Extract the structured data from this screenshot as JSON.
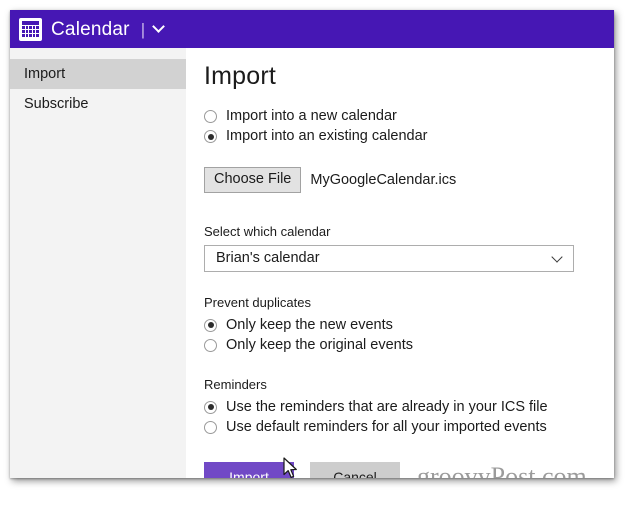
{
  "window": {
    "titlebar": {
      "icon": "calendar-icon",
      "app_title": "Calendar",
      "separator": "|",
      "chevron": "chevron-down-icon"
    }
  },
  "sidebar": {
    "items": [
      {
        "label": "Import",
        "selected": true
      },
      {
        "label": "Subscribe",
        "selected": false
      }
    ]
  },
  "main": {
    "page_title": "Import",
    "destination_options": [
      {
        "label": "Import into a new calendar",
        "selected": false
      },
      {
        "label": "Import into an existing calendar",
        "selected": true
      }
    ],
    "file_picker": {
      "button_label": "Choose File",
      "file_name": "MyGoogleCalendar.ics"
    },
    "calendar_group": {
      "label": "Select which calendar",
      "selected_value": "Brian's calendar",
      "chevron": "chevron-down-icon"
    },
    "duplicates_group": {
      "label": "Prevent duplicates",
      "options": [
        {
          "label": "Only keep the new events",
          "selected": true
        },
        {
          "label": "Only keep the original events",
          "selected": false
        }
      ]
    },
    "reminders_group": {
      "label": "Reminders",
      "options": [
        {
          "label": "Use the reminders that are already in your ICS file",
          "selected": true
        },
        {
          "label": "Use default reminders for all your imported events",
          "selected": false
        }
      ]
    },
    "actions": {
      "primary_label": "Import",
      "secondary_label": "Cancel"
    }
  },
  "watermark": {
    "text": "groovyPost.com"
  },
  "colors": {
    "titlebar_purple": "#4617b4",
    "primary_button_purple": "#7149c6",
    "sidebar_bg": "#f3f3f3",
    "sidebar_selected": "#d2d2d2",
    "cancel_button_gray": "#cdcdcd",
    "watermark_gray": "#9b9b9b"
  }
}
